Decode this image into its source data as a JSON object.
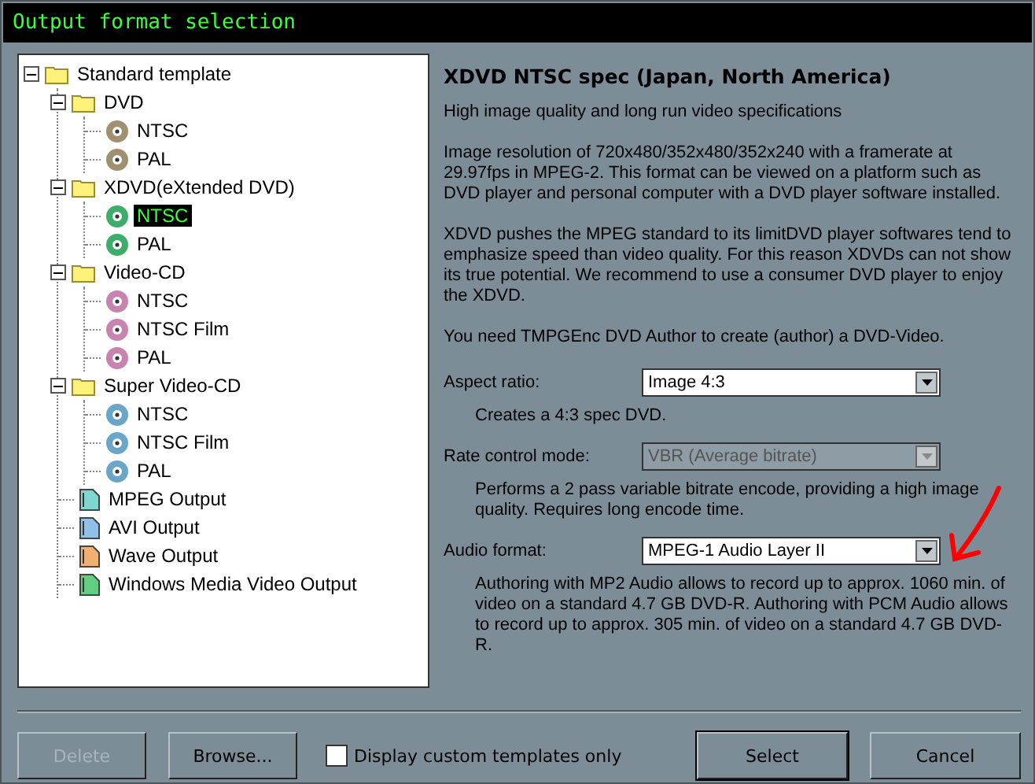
{
  "window": {
    "title": "Output format selection"
  },
  "tree": [
    {
      "label": "Standard template",
      "kind": "folder",
      "expanded": true,
      "selected": false,
      "children": [
        {
          "label": "DVD",
          "kind": "folder",
          "expanded": true,
          "selected": false,
          "children": [
            {
              "label": "NTSC",
              "kind": "disc",
              "color": "#a09070",
              "selected": false
            },
            {
              "label": "PAL",
              "kind": "disc",
              "color": "#a09070",
              "selected": false
            }
          ]
        },
        {
          "label": "XDVD(eXtended DVD)",
          "kind": "folder",
          "expanded": true,
          "selected": false,
          "children": [
            {
              "label": "NTSC",
              "kind": "disc",
              "color": "#3cae6a",
              "selected": true
            },
            {
              "label": "PAL",
              "kind": "disc",
              "color": "#3cae6a",
              "selected": false
            }
          ]
        },
        {
          "label": "Video-CD",
          "kind": "folder",
          "expanded": true,
          "selected": false,
          "children": [
            {
              "label": "NTSC",
              "kind": "disc",
              "color": "#c883b0",
              "selected": false
            },
            {
              "label": "NTSC Film",
              "kind": "disc",
              "color": "#c883b0",
              "selected": false
            },
            {
              "label": "PAL",
              "kind": "disc",
              "color": "#c883b0",
              "selected": false
            }
          ]
        },
        {
          "label": "Super Video-CD",
          "kind": "folder",
          "expanded": true,
          "selected": false,
          "children": [
            {
              "label": "NTSC",
              "kind": "disc",
              "color": "#6aa6c8",
              "selected": false
            },
            {
              "label": "NTSC Film",
              "kind": "disc",
              "color": "#6aa6c8",
              "selected": false
            },
            {
              "label": "PAL",
              "kind": "disc",
              "color": "#6aa6c8",
              "selected": false
            }
          ]
        },
        {
          "label": "MPEG Output",
          "kind": "file",
          "color": "#7fd8d0",
          "selected": false
        },
        {
          "label": "AVI Output",
          "kind": "file",
          "color": "#8ec0e8",
          "selected": false
        },
        {
          "label": "Wave Output",
          "kind": "file",
          "color": "#f0b070",
          "selected": false
        },
        {
          "label": "Windows Media Video Output",
          "kind": "file",
          "color": "#60d080",
          "selected": false
        }
      ]
    }
  ],
  "details": {
    "heading": "XDVD NTSC spec (Japan, North America)",
    "paragraphs": [
      "High image quality and long run video specifications",
      "Image resolution of 720x480/352x480/352x240 with a framerate at 29.97fps in MPEG-2. This format can be viewed on a platform such as DVD player and personal computer with a DVD player software installed.",
      "XDVD pushes the MPEG standard to its limitDVD player softwares tend to emphasize speed than video quality. For this reason XDVDs can not show its true potential. We recommend to use a consumer DVD player to enjoy the XDVD.",
      "You need TMPGEnc DVD Author to create (author) a DVD-Video."
    ],
    "settings": [
      {
        "label": "Aspect ratio:",
        "value": "Image 4:3",
        "disabled": false,
        "note": "Creates a 4:3 spec DVD."
      },
      {
        "label": "Rate control mode:",
        "value": "VBR (Average bitrate)",
        "disabled": true,
        "note": "Performs a 2 pass variable bitrate encode, providing a high image quality. Requires long encode time."
      },
      {
        "label": "Audio format:",
        "value": "MPEG-1 Audio Layer II",
        "disabled": false,
        "note": "Authoring with MP2 Audio allows to record up to approx. 1060 min. of video on a standard 4.7 GB DVD-R. Authoring with PCM Audio allows to record up to approx. 305 min. of video on a standard 4.7 GB DVD-R."
      }
    ]
  },
  "footer": {
    "delete": {
      "label": "Delete",
      "disabled": true
    },
    "browse": {
      "label": "Browse...",
      "disabled": false
    },
    "custom_only": {
      "label": "Display custom templates only",
      "checked": false
    },
    "select": {
      "label": "Select",
      "disabled": false
    },
    "cancel": {
      "label": "Cancel",
      "disabled": false
    }
  }
}
